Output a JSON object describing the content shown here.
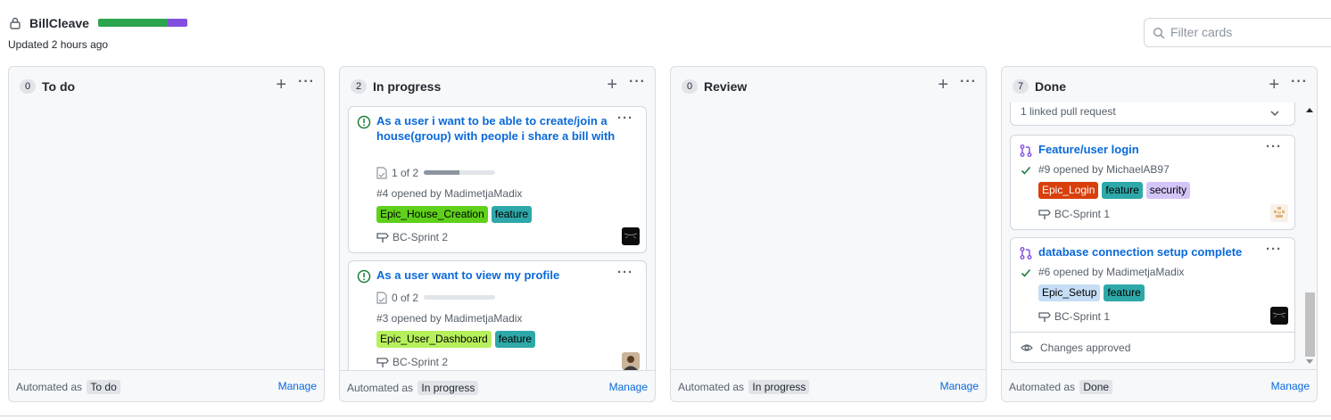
{
  "header": {
    "board_name": "BillCleave",
    "updated": "Updated 2 hours ago",
    "progress": {
      "done_fraction": 0.78,
      "in_progress_fraction": 0.22,
      "done_color": "#2da44e",
      "in_progress_color": "#8250df"
    },
    "filter_placeholder": "Filter cards"
  },
  "columns": [
    {
      "count": "0",
      "title": "To do",
      "automated_label": "Automated as",
      "automated_value": "To do",
      "manage": "Manage"
    },
    {
      "count": "2",
      "title": "In progress",
      "automated_label": "Automated as",
      "automated_value": "In progress",
      "manage": "Manage"
    },
    {
      "count": "0",
      "title": "Review",
      "automated_label": "Automated as",
      "automated_value": "In progress",
      "manage": "Manage"
    },
    {
      "count": "7",
      "title": "Done",
      "automated_label": "Automated as",
      "automated_value": "Done",
      "manage": "Manage"
    }
  ],
  "in_progress_cards": [
    {
      "title": "As a user i want to be able to create/join a house(group) with people i share a bill with",
      "tasks": "1 of 2",
      "tasks_fraction": 0.5,
      "opened": "#4 opened by MadimetjaMadix",
      "labels": [
        {
          "text": "Epic_House_Creation",
          "bg": "#5fd11a",
          "fg": "#000000"
        },
        {
          "text": "feature",
          "bg": "#2ea8a8",
          "fg": "#000000"
        }
      ],
      "milestone": "BC-Sprint 2"
    },
    {
      "title": "As a user want to view my profile",
      "tasks": "0 of 2",
      "tasks_fraction": 0,
      "opened": "#3 opened by MadimetjaMadix",
      "labels": [
        {
          "text": "Epic_User_Dashboard",
          "bg": "#b6f05b",
          "fg": "#000000"
        },
        {
          "text": "feature",
          "bg": "#2ea8a8",
          "fg": "#000000"
        }
      ],
      "milestone": "BC-Sprint 2"
    }
  ],
  "done_cards": {
    "linked": "1 linked pull request",
    "prs": [
      {
        "title": "Feature/user login",
        "opened": "#9 opened by MichaelAB97",
        "labels": [
          {
            "text": "Epic_Login",
            "bg": "#d93f0b",
            "fg": "#ffffff"
          },
          {
            "text": "feature",
            "bg": "#2ea8a8",
            "fg": "#000000"
          },
          {
            "text": "security",
            "bg": "#d4c5f9",
            "fg": "#000000"
          }
        ],
        "milestone": "BC-Sprint 1"
      },
      {
        "title": "database connection setup complete",
        "opened": "#6 opened by MadimetjaMadix",
        "labels": [
          {
            "text": "Epic_Setup",
            "bg": "#c5def5",
            "fg": "#000000"
          },
          {
            "text": "feature",
            "bg": "#2ea8a8",
            "fg": "#000000"
          }
        ],
        "milestone": "BC-Sprint 1",
        "approved": "Changes approved"
      }
    ]
  },
  "icons": {
    "lock": "lock-icon",
    "search": "search-icon",
    "issue": "issue-open-icon",
    "pull_request": "pull-request-icon",
    "check": "check-icon",
    "milestone": "milestone-icon",
    "tasklist": "tasklist-icon",
    "eye": "eye-icon",
    "chevron": "chevron-down-icon"
  }
}
